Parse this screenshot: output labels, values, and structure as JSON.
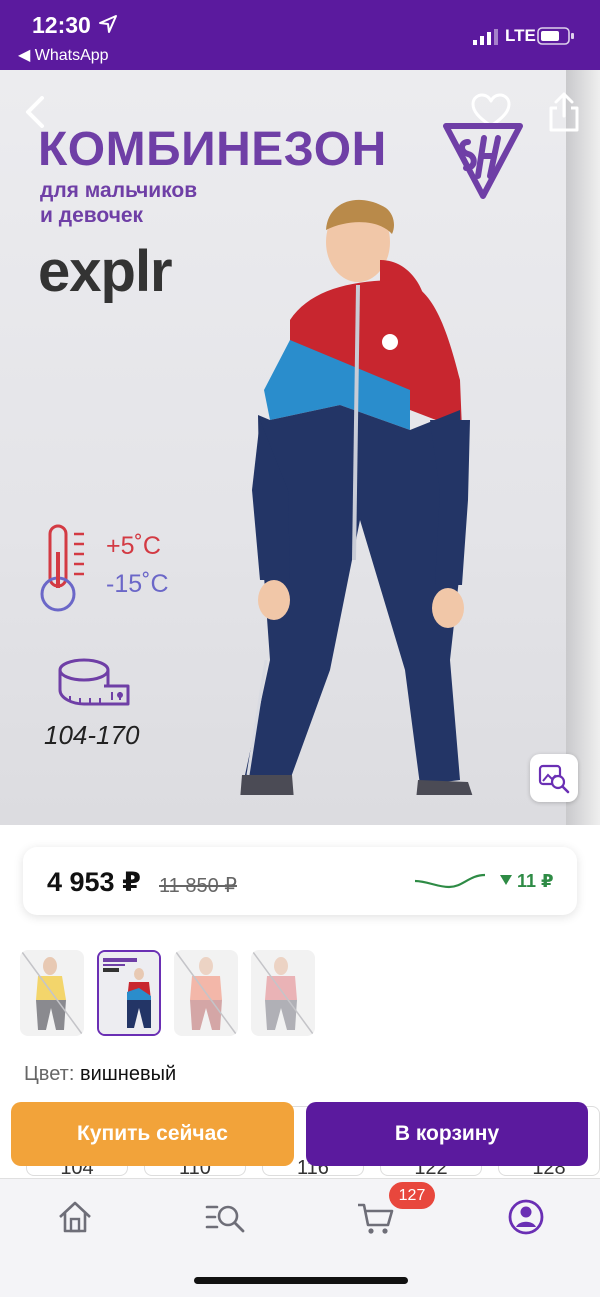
{
  "status_bar": {
    "time": "12:30",
    "back_app": "◀ WhatsApp",
    "network": "LTE"
  },
  "hero": {
    "title": "КОМБИНЕЗОН",
    "subtitle_line1": "для мальчиков",
    "subtitle_line2": "и девочек",
    "brand": "explr",
    "temp_high": "+5˚C",
    "temp_low": "-15˚C",
    "size_range": "104-170"
  },
  "price_card": {
    "price": "4 953 ₽",
    "old_price": "11 850 ₽",
    "price_drop": "11 ₽"
  },
  "color": {
    "label": "Цвет:",
    "value": "вишневый"
  },
  "sizes": [
    "104",
    "110",
    "116",
    "122",
    "128"
  ],
  "actions": {
    "buy_now": "Купить сейчас",
    "add_to_cart": "В корзину"
  },
  "tabbar": {
    "cart_badge": "127",
    "icons": [
      "home-icon",
      "catalog-search-icon",
      "cart-icon",
      "profile-icon"
    ]
  },
  "colors": {
    "brand_purple": "#5b1a9e",
    "buy_orange": "#f2a33a",
    "badge_red": "#e8473d",
    "drop_green": "#2e8b45"
  }
}
